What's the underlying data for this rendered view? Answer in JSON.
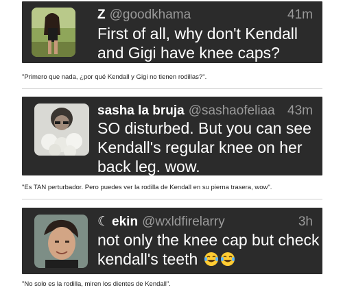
{
  "tweets": [
    {
      "name": "Z",
      "handle": "@goodkhama",
      "time": "41m",
      "text_lines": [
        "First of all, why don't Kendall",
        "and Gigi have knee caps?"
      ],
      "caption": "\"Primero que nada, ¿por qué Kendall y Gigi no tienen rodillas?\"."
    },
    {
      "name": "sasha la bruja",
      "handle": "@sashaofeliaa",
      "time": "43m",
      "text_lines": [
        "SO disturbed. But you can see",
        "Kendall's regular knee on her",
        "back leg. wow."
      ],
      "caption": "\"Es TAN perturbador. Pero puedes ver la rodilla de Kendall en su pierna trasera, wow\"."
    },
    {
      "name": "ekin",
      "name_prefix": "☾",
      "handle": "@wxldfirelarry",
      "time": "3h",
      "text_lines": [
        "not only the knee cap but check",
        "kendall's teeth"
      ],
      "emoji": [
        "face-with-tears-of-joy",
        "face-with-tears-of-joy"
      ],
      "caption": "\"No solo es la rodilla, miren los dientes de Kendall\"."
    }
  ],
  "colors": {
    "tweet_bg": "#2b2b2b",
    "handle_gray": "#9a9a9a",
    "text_white": "#ffffff",
    "divider": "#cfcfcf"
  }
}
